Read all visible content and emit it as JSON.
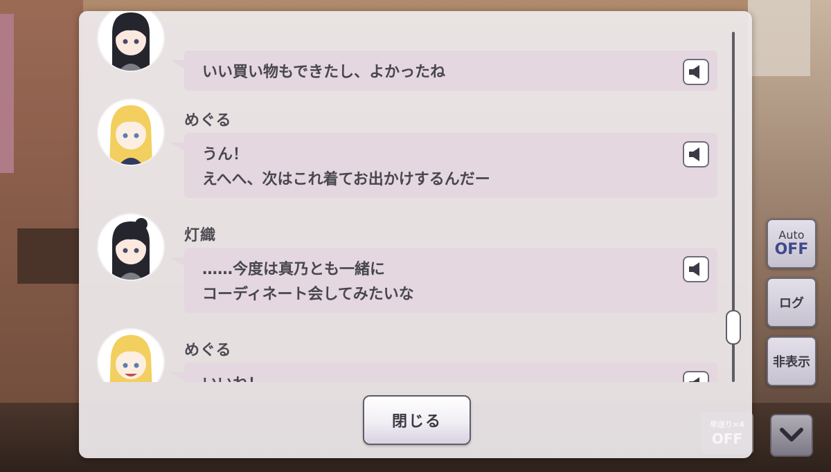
{
  "log": {
    "entries": [
      {
        "speaker": "",
        "avatar": "toori-avatar",
        "line1": "いい買い物もできたし、よかったね",
        "line2": ""
      },
      {
        "speaker": "めぐる",
        "avatar": "meguru-avatar",
        "line1": "うん！",
        "line2": "えへへ、次はこれ着てお出かけするんだー"
      },
      {
        "speaker": "灯織",
        "avatar": "toori-avatar",
        "line1": "……今度は真乃とも一緒に",
        "line2": "コーディネート会してみたいな"
      },
      {
        "speaker": "めぐる",
        "avatar": "meguru-avatar",
        "line1": "いいね！",
        "line2": ""
      }
    ],
    "voice_icon": "speaker-icon",
    "close_label": "閉じる"
  },
  "controls": {
    "auto_label": "Auto",
    "auto_state": "OFF",
    "log_label": "ログ",
    "hide_label": "非表示",
    "skip_label": "早送り×4",
    "skip_state": "OFF",
    "menu_icon": "chevron-down-icon"
  },
  "colors": {
    "bubble": "#e4d7e0",
    "panel": "#eeeaec",
    "accent": "#3f4a8a"
  }
}
